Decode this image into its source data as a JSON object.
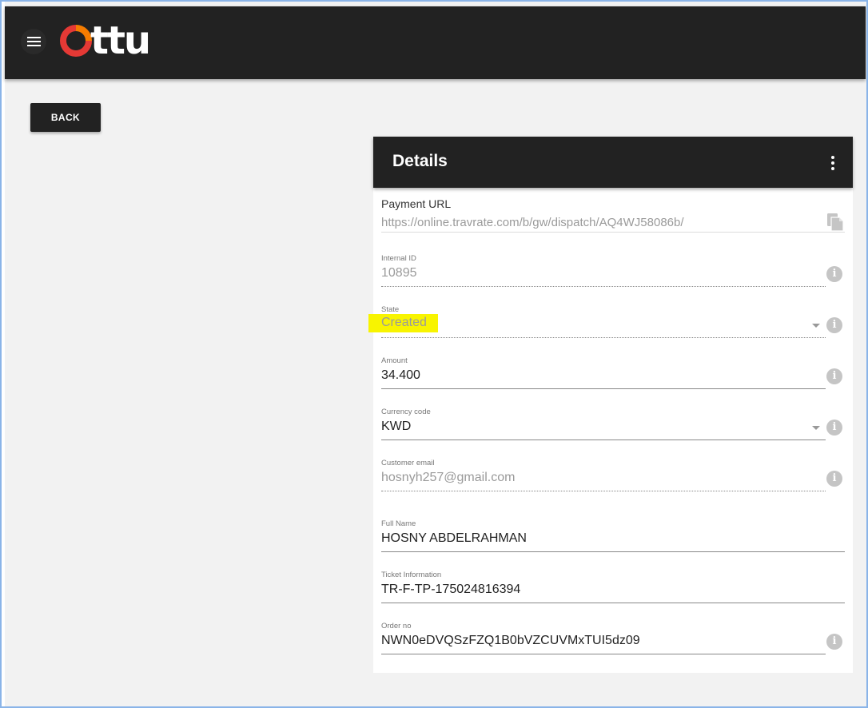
{
  "app": {
    "logo_text": "ttu",
    "brand_colors": [
      "#e53935",
      "#f57c00",
      "#222222"
    ]
  },
  "nav": {
    "menu_icon": "hamburger-menu-icon",
    "back_label": "BACK"
  },
  "details": {
    "title": "Details",
    "more_icon": "more-vertical-icon",
    "fields": {
      "payment_url": {
        "label": "Payment URL",
        "value": "https://online.travrate.com/b/gw/dispatch/AQ4WJ58086b/",
        "icon": "copy-icon"
      },
      "internal_id": {
        "label": "Internal ID",
        "value": "10895"
      },
      "state": {
        "label": "State",
        "value": "Created"
      },
      "amount": {
        "label": "Amount",
        "value": "34.400"
      },
      "currency": {
        "label": "Currency code",
        "value": "KWD"
      },
      "email": {
        "label": "Customer email",
        "value": "hosnyh257@gmail.com"
      },
      "full_name": {
        "label": "Full Name",
        "value": "HOSNY ABDELRAHMAN"
      },
      "ticket": {
        "label": "Ticket Information",
        "value": "TR-F-TP-175024816394"
      },
      "order_no": {
        "label": "Order no",
        "value": "NWN0eDVQSzFZQ1B0bVZCUVMxTUI5dz09"
      }
    },
    "info_glyph": "i"
  }
}
